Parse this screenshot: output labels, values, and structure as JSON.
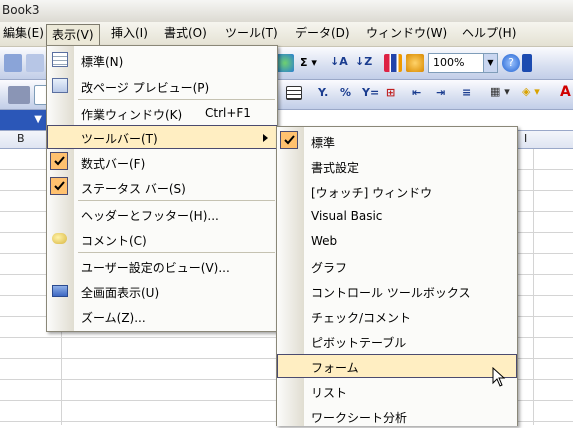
{
  "window": {
    "title": "Book3"
  },
  "menubar": {
    "items": [
      {
        "label": "編集(E)"
      },
      {
        "label": "表示(V)"
      },
      {
        "label": "挿入(I)"
      },
      {
        "label": "書式(O)"
      },
      {
        "label": "ツール(T)"
      },
      {
        "label": "データ(D)"
      },
      {
        "label": "ウィンドウ(W)"
      },
      {
        "label": "ヘルプ(H)"
      }
    ]
  },
  "toolbar": {
    "zoom_value": "100%"
  },
  "columns": {
    "b": "B",
    "i": "I"
  },
  "view_menu": {
    "items": [
      {
        "label": "標準(N)",
        "icon": "normal-view-icon"
      },
      {
        "label": "改ページ プレビュー(P)",
        "icon": "page-break-preview-icon"
      },
      {
        "label": "作業ウィンドウ(K)",
        "shortcut": "Ctrl+F1"
      },
      {
        "label": "ツールバー(T)",
        "submenu": true
      },
      {
        "label": "数式バー(F)",
        "checked": true
      },
      {
        "label": "ステータス バー(S)",
        "checked": true
      },
      {
        "label": "ヘッダーとフッター(H)..."
      },
      {
        "label": "コメント(C)",
        "icon": "comment-icon"
      },
      {
        "label": "ユーザー設定のビュー(V)..."
      },
      {
        "label": "全画面表示(U)",
        "icon": "full-screen-icon"
      },
      {
        "label": "ズーム(Z)..."
      }
    ]
  },
  "toolbars_submenu": {
    "items": [
      {
        "label": "標準",
        "checked": true
      },
      {
        "label": "書式設定"
      },
      {
        "label": "[ウォッチ] ウィンドウ"
      },
      {
        "label": "Visual Basic"
      },
      {
        "label": "Web"
      },
      {
        "label": "グラフ"
      },
      {
        "label": "コントロール ツールボックス"
      },
      {
        "label": "チェック/コメント"
      },
      {
        "label": "ピボットテーブル"
      },
      {
        "label": "フォーム",
        "highlighted": true
      },
      {
        "label": "リスト"
      },
      {
        "label": "ワークシート分析"
      }
    ]
  },
  "colors": {
    "highlight": "#ffeec2",
    "check_bg": "#ffc16f",
    "menu_border": "#8a8778"
  }
}
